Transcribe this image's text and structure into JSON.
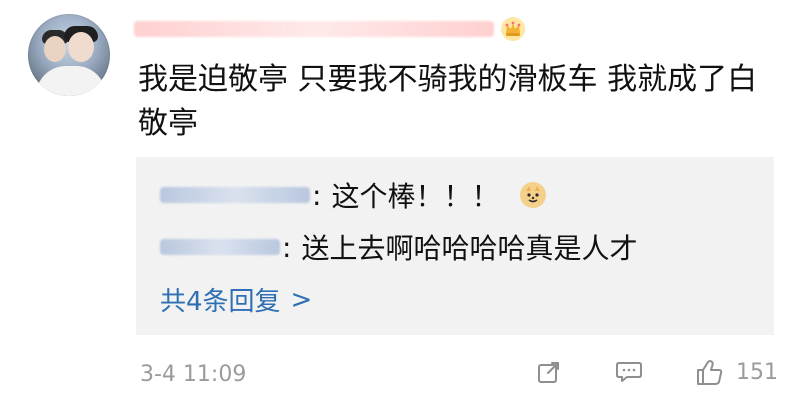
{
  "comment": {
    "username_icon": "crown-icon",
    "text": "我是迫敬亭 只要我不骑我的滑板车 我就成了白敬亭",
    "replies": [
      {
        "text": "这个棒！！！",
        "emoji_icon": "doge-emoji-icon"
      },
      {
        "text": "送上去啊哈哈哈哈真是人才"
      }
    ],
    "more_replies_label": "共4条回复",
    "more_replies_chevron": ">",
    "timestamp": "3-4 11:09",
    "like_count": "151",
    "icons": {
      "share": "share-icon",
      "comment": "comment-icon",
      "like": "thumbs-up-icon"
    }
  }
}
